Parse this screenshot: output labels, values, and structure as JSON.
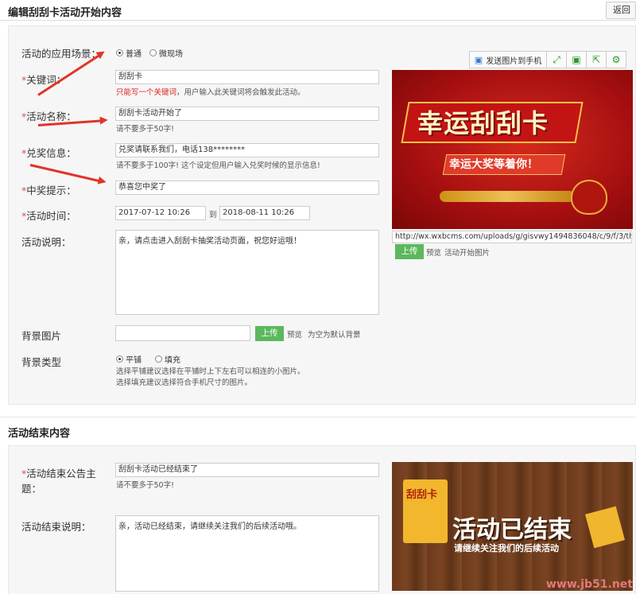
{
  "header": {
    "title": "编辑刮刮卡活动开始内容",
    "back_label": "返回"
  },
  "start": {
    "scene_label": "活动的应用场景：",
    "scene_options": [
      {
        "label": "普通",
        "selected": true
      },
      {
        "label": "微现场",
        "selected": false
      }
    ],
    "keyword_label": "关键词：",
    "keyword_value": "刮刮卡",
    "keyword_hint": "只能写一个关键词",
    "keyword_hint2": "，用户输入此关键词将会触发此活动。",
    "name_label": "活动名称：",
    "name_value": "刮刮卡活动开始了",
    "name_hint": "请不要多于50字!",
    "prize_label": "兑奖信息：",
    "prize_value": "兑奖请联系我们，电话138********",
    "prize_hint": "请不要多于100字! 这个设定但用户输入兑奖时候的显示信息!",
    "win_label": "中奖提示：",
    "win_value": "恭喜您中奖了",
    "time_label": "活动时间：",
    "time_start": "2017-07-12 10:26",
    "time_to": "到",
    "time_end": "2018-08-11 10:26",
    "desc_label": "活动说明：",
    "desc_value": "亲，请点击进入刮刮卡抽奖活动页面，祝您好运哦！",
    "bg_image_label": "背景图片",
    "upload_label": "上传",
    "preview_label": "预览",
    "bg_default_hint": "为空为默认背景",
    "bg_type_label": "背景类型",
    "bg_type_options": [
      {
        "label": "平铺",
        "selected": true
      },
      {
        "label": "填充",
        "selected": false
      }
    ],
    "bg_type_hint1": "选择平铺建议选择在平铺时上下左右可以相连的小图片。",
    "bg_type_hint2": "选择填充建议选择符合手机尺寸的图片。"
  },
  "toolbar": {
    "send_label": "发送图片到手机",
    "icons": [
      "expand-icon",
      "save-icon",
      "share-icon",
      "gear-icon"
    ]
  },
  "start_image": {
    "title": "幸运刮刮卡",
    "subtitle": "幸运大奖等着你！",
    "url": "http://wx.wxbcms.com/uploads/g/gisvwy1494836048/c/9/f/3/th",
    "upload_label": "上传",
    "preview_label": "预览",
    "caption": "活动开始图片"
  },
  "end": {
    "section_title": "活动结束内容",
    "title_label": "活动结束公告主",
    "title_label2": "题：",
    "title_value": "刮刮卡活动已经结束了",
    "title_hint": "请不要多于50字!",
    "desc_label": "活动结束说明：",
    "desc_value": "亲，活动已经结束，请继续关注我们的后续活动哦。"
  },
  "end_image": {
    "tag_text": "刮刮卡",
    "title": "活动已结束",
    "subtitle": "请继续关注我们的后续活动"
  },
  "watermark": "www.jb51.net",
  "colors": {
    "required": "#d9534f",
    "green": "#5cb85c",
    "arrow": "#e0342b"
  }
}
